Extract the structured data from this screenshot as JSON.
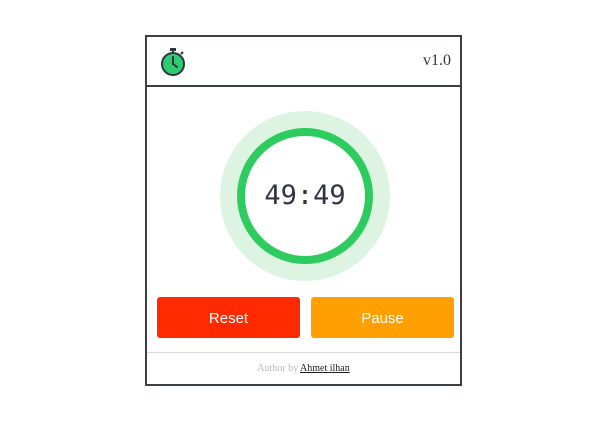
{
  "header": {
    "logo_icon": "stopwatch-icon",
    "version": "v1.0"
  },
  "timer": {
    "display": "49:49",
    "progress_fraction": 1.0,
    "ring_color": "#2ecc5e",
    "ring_track_color": "#dcf4e1"
  },
  "buttons": {
    "reset_label": "Reset",
    "reset_color": "#ff2a00",
    "pause_label": "Pause",
    "pause_color": "#ff9f00"
  },
  "footer": {
    "author_prefix": "Author by",
    "author_name": "Ahmet ilhan"
  }
}
